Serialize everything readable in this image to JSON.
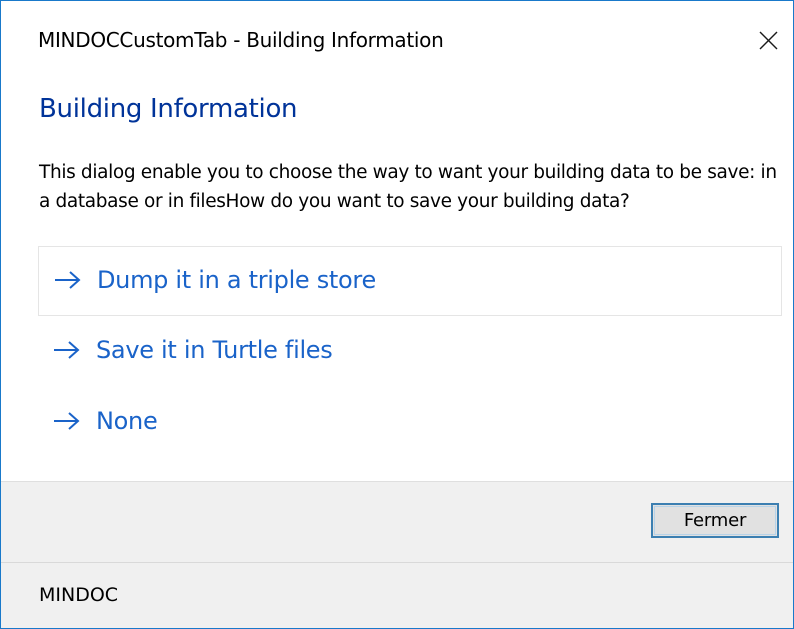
{
  "window": {
    "title": "MINDOCCustomTab - Building Information"
  },
  "content": {
    "heading": "Building Information",
    "description": "This dialog enable you to choose the way to want your building data to be save: in a database or in filesHow do you want to save your building data?",
    "links": [
      {
        "label": "Dump it in a triple store",
        "icon": "right-arrow-icon"
      },
      {
        "label": "Save it in Turtle files",
        "icon": "right-arrow-icon"
      },
      {
        "label": "None",
        "icon": "right-arrow-icon"
      }
    ]
  },
  "footer": {
    "close_label": "Fermer"
  },
  "statusbar": {
    "text": "MINDOC"
  },
  "colors": {
    "window_border": "#1979ca",
    "heading": "#003399",
    "link": "#1a63c9",
    "footer_bg": "#f0f0f0",
    "button_border": "#3c7fb1"
  }
}
